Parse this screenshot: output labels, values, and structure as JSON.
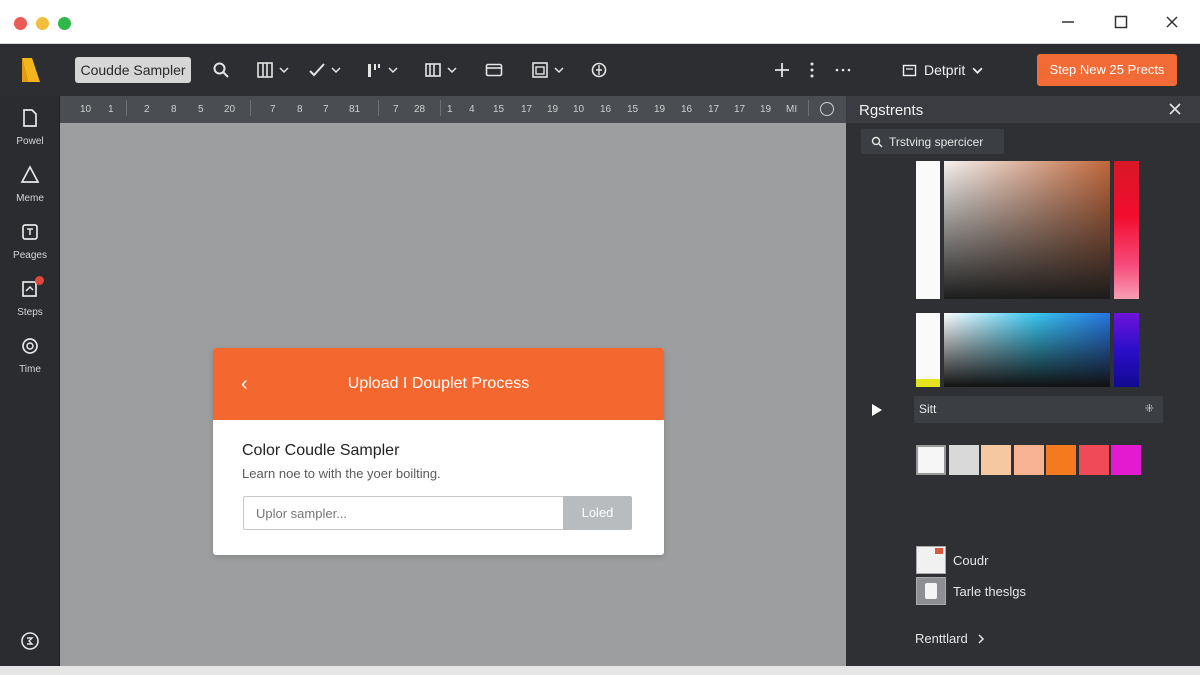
{
  "toolbar": {
    "label": "Coudde Sampler",
    "doc_select": "Detprit",
    "cta": "Step New 25 Prects"
  },
  "sidebar": {
    "items": [
      {
        "label": "Powel",
        "icon": "file-icon"
      },
      {
        "label": "Meme",
        "icon": "triangle-icon"
      },
      {
        "label": "Peages",
        "icon": "pages-icon"
      },
      {
        "label": "Steps",
        "icon": "steps-icon"
      },
      {
        "label": "Time",
        "icon": "gear-icon"
      }
    ]
  },
  "ruler": {
    "ticks": [
      "10",
      "1",
      "2",
      "8",
      "5",
      "20",
      "7",
      "8",
      "7",
      "81",
      "7",
      "28",
      "1",
      "4",
      "15",
      "17",
      "19",
      "10",
      "16",
      "15",
      "19",
      "16",
      "17",
      "17",
      "19",
      "MI"
    ]
  },
  "dialog": {
    "title": "Upload I Douplet Process",
    "heading": "Color Coudle Sampler",
    "subtitle": "Learn noe to with the yoer boilting.",
    "input_placeholder": "Uplor sampler...",
    "button": "Loled"
  },
  "panel": {
    "title": "Rgstrents",
    "search": "Trstving spercicer",
    "field": "Sitt",
    "field_icon": "⁜",
    "swatches": [
      "#f6f6f6",
      "#d9d9d9",
      "#f6c8a2",
      "#f7b293",
      "#f57a1f",
      "#ef4a55",
      "#e21bd1"
    ],
    "items": [
      {
        "label": "Coudr"
      },
      {
        "label": "Tarle theslgs"
      }
    ],
    "footer": "Renttlard"
  }
}
